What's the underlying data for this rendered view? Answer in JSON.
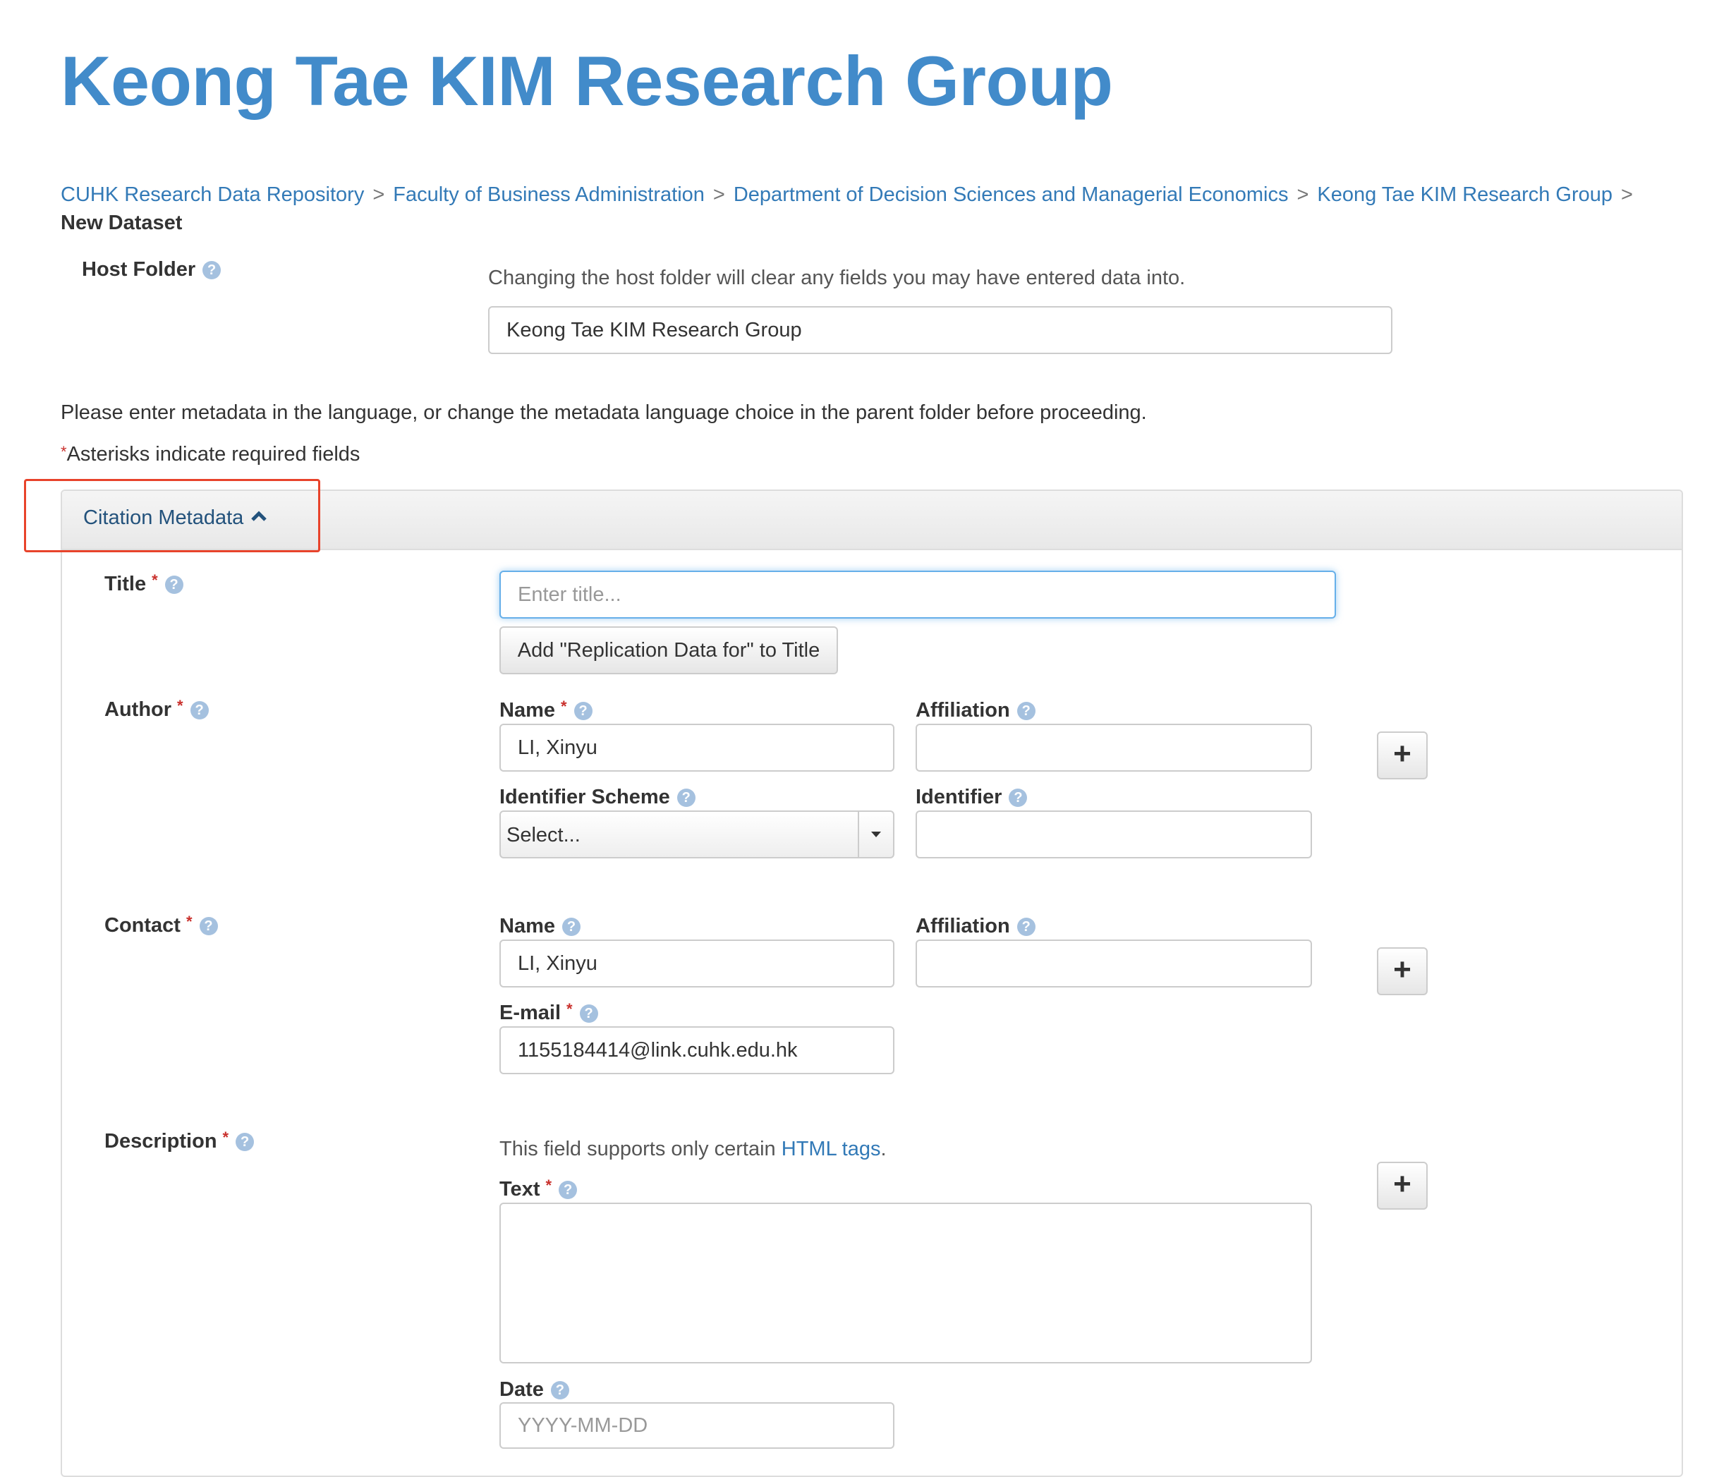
{
  "site": {
    "brand": "Keong Tae KIM Research Group"
  },
  "breadcrumbs": {
    "items": [
      "CUHK Research Data Repository",
      "Faculty of Business Administration",
      "Department of Decision Sciences and Managerial Economics",
      "Keong Tae KIM Research Group"
    ],
    "separator": ">",
    "current": "New Dataset"
  },
  "host_folder": {
    "label": "Host Folder",
    "hint": "Changing the host folder will clear any fields you may have entered data into.",
    "value": "Keong Tae KIM Research Group"
  },
  "notices": {
    "language": "Please enter metadata in the language, or change the metadata language choice in the parent folder before proceeding.",
    "required_mark": "*",
    "required_text": "Asterisks indicate required fields"
  },
  "citation": {
    "heading": "Citation Metadata",
    "title": {
      "label": "Title",
      "placeholder": "Enter title...",
      "add_button": "Add \"Replication Data for\" to Title"
    },
    "author": {
      "label": "Author",
      "name_label": "Name",
      "name_value": "LI, Xinyu",
      "affiliation_label": "Affiliation",
      "affiliation_value": "",
      "scheme_label": "Identifier Scheme",
      "scheme_value": "Select...",
      "identifier_label": "Identifier",
      "identifier_value": ""
    },
    "contact": {
      "label": "Contact",
      "name_label": "Name",
      "name_value": "LI, Xinyu",
      "affiliation_label": "Affiliation",
      "affiliation_value": "",
      "email_label": "E-mail",
      "email_value": "1155184414@link.cuhk.edu.hk"
    },
    "description": {
      "label": "Description",
      "hint_prefix": "This field supports only certain ",
      "hint_link": "HTML tags",
      "hint_suffix": ".",
      "text_label": "Text",
      "text_value": "",
      "date_label": "Date",
      "date_placeholder": "YYYY-MM-DD"
    },
    "plus_label": "+",
    "required_mark": "*",
    "help_glyph": "?"
  },
  "colors": {
    "brand": "#428bca",
    "link": "#337ab7",
    "required": "#c9302c",
    "highlight": "#e8432b"
  },
  "icons": [
    "help-icon",
    "chevron-up-icon",
    "caret-down-icon",
    "plus-icon"
  ]
}
